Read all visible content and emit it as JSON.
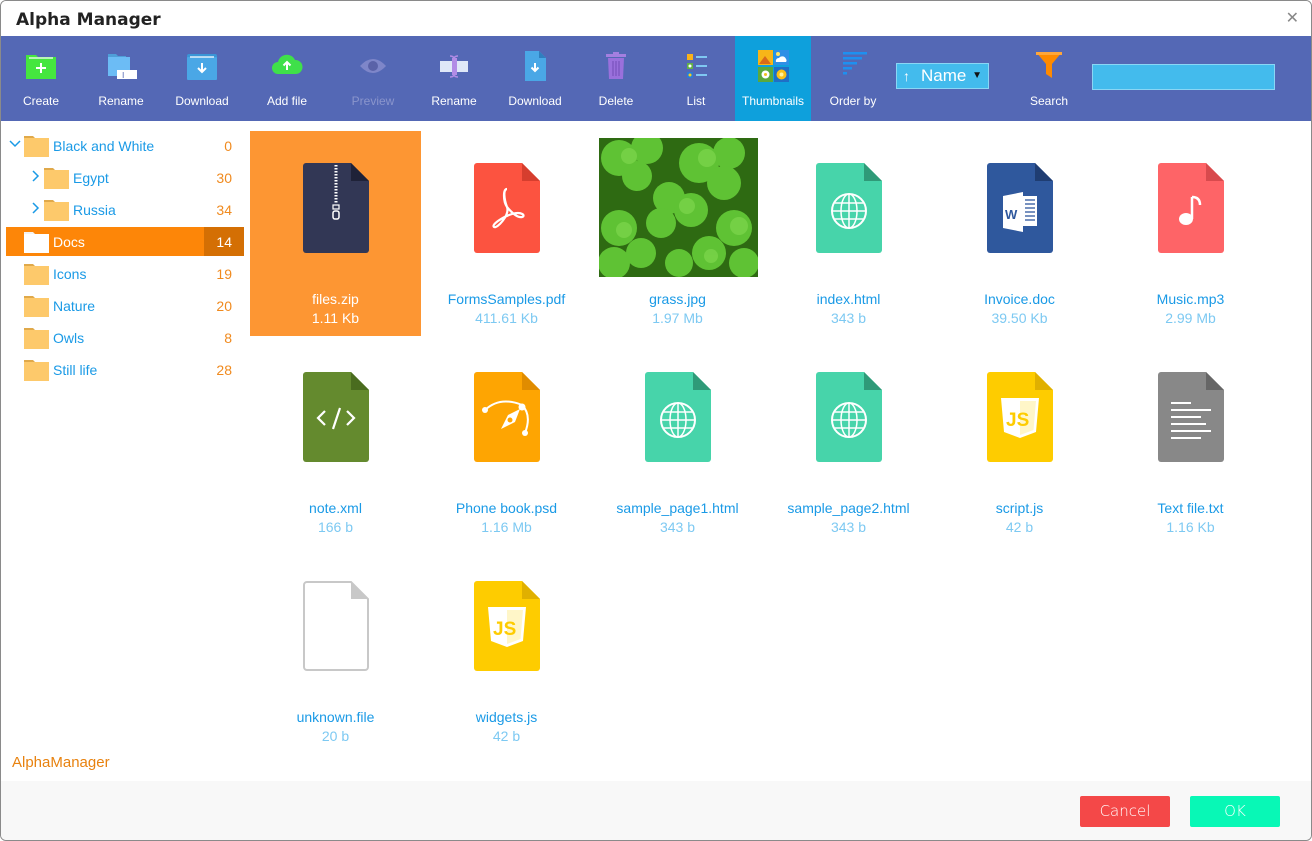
{
  "window": {
    "title": "Alpha Manager",
    "close_icon": "close-icon"
  },
  "toolbar": {
    "buttons": [
      {
        "id": "create",
        "label": "Create",
        "icon": "folder-plus-icon",
        "state": "enabled"
      },
      {
        "id": "rename-folder",
        "label": "Rename",
        "icon": "folder-rename-icon",
        "state": "enabled"
      },
      {
        "id": "download-folder",
        "label": "Download",
        "icon": "folder-download-icon",
        "state": "enabled"
      },
      {
        "id": "add-file",
        "label": "Add file",
        "icon": "cloud-upload-icon",
        "state": "enabled"
      },
      {
        "id": "preview",
        "label": "Preview",
        "icon": "eye-icon",
        "state": "disabled"
      },
      {
        "id": "rename-file",
        "label": "Rename",
        "icon": "text-cursor-icon",
        "state": "enabled"
      },
      {
        "id": "download-file",
        "label": "Download",
        "icon": "file-download-icon",
        "state": "enabled"
      },
      {
        "id": "delete",
        "label": "Delete",
        "icon": "trash-icon",
        "state": "enabled"
      },
      {
        "id": "list",
        "label": "List",
        "icon": "list-view-icon",
        "state": "enabled"
      },
      {
        "id": "thumbnails",
        "label": "Thumbnails",
        "icon": "thumbnails-icon",
        "state": "active"
      },
      {
        "id": "order-by",
        "label": "Order by",
        "icon": "sort-icon",
        "state": "enabled"
      },
      {
        "id": "search",
        "label": "Search",
        "icon": "filter-icon",
        "state": "enabled"
      }
    ],
    "order_select": {
      "direction_symbol": "↑",
      "value": "Name",
      "caret": "▼"
    },
    "search_input": {
      "value": "",
      "placeholder": ""
    }
  },
  "sidebar": {
    "folders": [
      {
        "name": "Black and White",
        "count": "0",
        "expanded": true,
        "has_children": true,
        "level": 0
      },
      {
        "name": "Egypt",
        "count": "30",
        "expanded": false,
        "has_children": true,
        "level": 1
      },
      {
        "name": "Russia",
        "count": "34",
        "expanded": false,
        "has_children": true,
        "level": 1
      },
      {
        "name": "Docs",
        "count": "14",
        "selected": true,
        "level": 0
      },
      {
        "name": "Icons",
        "count": "19",
        "level": 0
      },
      {
        "name": "Nature",
        "count": "20",
        "level": 0
      },
      {
        "name": "Owls",
        "count": "8",
        "level": 0
      },
      {
        "name": "Still life",
        "count": "28",
        "level": 0
      }
    ]
  },
  "files": [
    {
      "name": "files.zip",
      "size": "1.11 Kb",
      "type": "zip",
      "selected": true
    },
    {
      "name": "FormsSamples.pdf",
      "size": "411.61 Kb",
      "type": "pdf"
    },
    {
      "name": "grass.jpg",
      "size": "1.97 Mb",
      "type": "image"
    },
    {
      "name": "index.html",
      "size": "343 b",
      "type": "html"
    },
    {
      "name": "Invoice.doc",
      "size": "39.50 Kb",
      "type": "doc"
    },
    {
      "name": "Music.mp3",
      "size": "2.99 Mb",
      "type": "mp3"
    },
    {
      "name": "note.xml",
      "size": "166 b",
      "type": "xml"
    },
    {
      "name": "Phone book.psd",
      "size": "1.16 Mb",
      "type": "psd"
    },
    {
      "name": "sample_page1.html",
      "size": "343 b",
      "type": "html"
    },
    {
      "name": "sample_page2.html",
      "size": "343 b",
      "type": "html"
    },
    {
      "name": "script.js",
      "size": "42 b",
      "type": "js"
    },
    {
      "name": "Text file.txt",
      "size": "1.16 Kb",
      "type": "txt"
    },
    {
      "name": "unknown.file",
      "size": "20 b",
      "type": "unknown"
    },
    {
      "name": "widgets.js",
      "size": "42 b",
      "type": "js"
    }
  ],
  "footer": {
    "brand": "AlphaManager",
    "cancel_label": "Cancel",
    "ok_label": "OK"
  },
  "colors": {
    "toolbar_bg": "#5468b5",
    "active_tool_bg": "#0ea0dc",
    "selected_orange": "#fd8608",
    "link_blue": "#1a9ae6",
    "count_orange": "#f08a1e",
    "cancel_red": "#f44848",
    "ok_green": "#08f8b6"
  }
}
